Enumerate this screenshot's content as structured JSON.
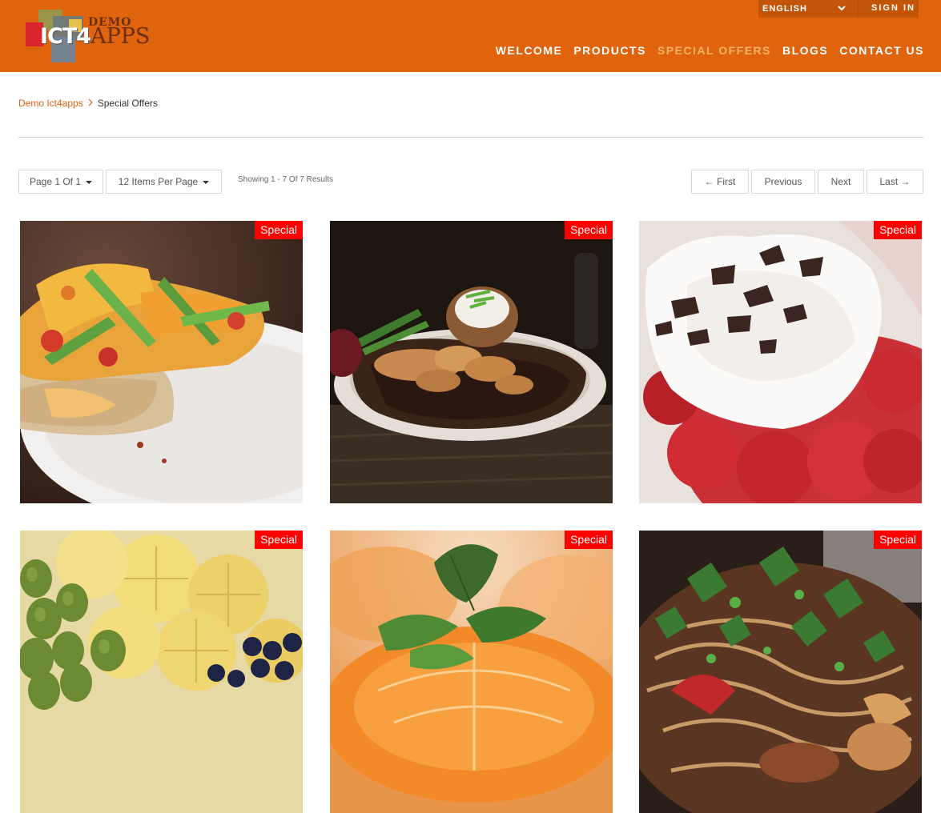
{
  "brand": {
    "logo_main": "ICT4",
    "logo_apps": "APPS",
    "logo_demo": "DEMO"
  },
  "topbar": {
    "language": "ENGLISH",
    "sign_in": "SIGN IN"
  },
  "nav": {
    "items": [
      {
        "label": "WELCOME"
      },
      {
        "label": "PRODUCTS"
      },
      {
        "label": "SPECIAL OFFERS",
        "active": true
      },
      {
        "label": "BLOGS"
      },
      {
        "label": "CONTACT US"
      }
    ]
  },
  "breadcrumb": {
    "home": "Demo Ict4apps",
    "current": "Special Offers"
  },
  "toolbar": {
    "page_select": "Page 1 Of 1",
    "per_page_select": "12 Items Per Page",
    "showing": "Showing 1 - 7 Of 7 Results",
    "first": "← First",
    "previous": "Previous",
    "next": "Next",
    "last": "Last →"
  },
  "products": [
    {
      "badge": "Special",
      "image": "mango-chicken-toast"
    },
    {
      "badge": "Special",
      "image": "steak-with-mushrooms-and-potato"
    },
    {
      "badge": "Special",
      "image": "strawberries-with-cream"
    },
    {
      "badge": "Special",
      "image": "pineapple-grapes-blueberries"
    },
    {
      "badge": "Special",
      "image": "orange-slices-with-mint"
    },
    {
      "badge": "Special",
      "image": "stir-fry-noodles"
    }
  ],
  "colors": {
    "header_bg": "#e0640d",
    "nav_active": "#f5b267",
    "badge_bg": "#ff0000",
    "link": "#e0640d"
  }
}
